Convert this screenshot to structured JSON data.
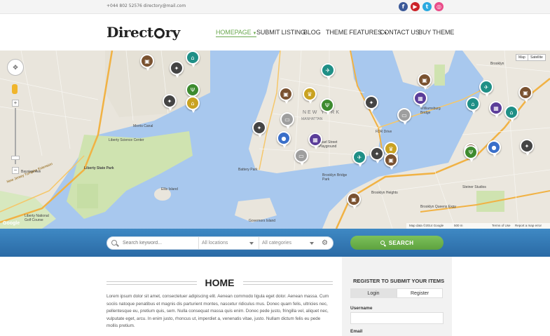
{
  "topbar": {
    "contact": "+044 802 52576 directory@mail.com",
    "social": [
      {
        "name": "facebook-icon",
        "glyph": "f",
        "color": "#3b5998"
      },
      {
        "name": "youtube-icon",
        "glyph": "▶",
        "color": "#cc2127"
      },
      {
        "name": "twitter-icon",
        "glyph": "t",
        "color": "#2aa9e0"
      },
      {
        "name": "dribbble-icon",
        "glyph": "◎",
        "color": "#ea4c89"
      }
    ]
  },
  "header": {
    "logo_left": "Direct",
    "logo_right": "ry",
    "nav": [
      {
        "label": "HOMEPAGE",
        "active": true,
        "dropdown": true
      },
      {
        "label": "SUBMIT LISTING",
        "active": false,
        "dropdown": false
      },
      {
        "label": "BLOG",
        "active": false,
        "dropdown": false
      },
      {
        "label": "THEME FEATURES",
        "active": false,
        "dropdown": true
      },
      {
        "label": "CONTACT US",
        "active": false,
        "dropdown": false
      },
      {
        "label": "BUY THEME",
        "active": false,
        "dropdown": false
      }
    ]
  },
  "map": {
    "type_map": "Map",
    "type_satellite": "Satellite",
    "attribution": "Map data ©2014 Google",
    "scale": "500 m",
    "terms": "Terms of Use",
    "report": "Report a map error",
    "google": "Google",
    "labels": {
      "new_york": "NEW YORK",
      "manhattan": "MANHATTAN",
      "brooklyn_heights": "Brooklyn Heights",
      "brooklyn": "Brooklyn",
      "liberty_state_park": "Liberty State Park",
      "ellis_island": "Ellis Island",
      "battery_park": "Battery Park",
      "governors_island": "Governors Island",
      "liberty_science": "Liberty Science Center",
      "morris_canal": "Morris Canal",
      "williamsburg": "Williamsburg Bridge",
      "brooklyn_bridge": "Brooklyn Bridge Park",
      "fdr_drive": "FDR Drive",
      "pearl_street": "Pearl Street Playground",
      "bqe": "Brooklyn Queens Expy",
      "nj_turnpike": "New Jersey Turnpike Extension",
      "bayview": "Bayview Ave",
      "liberty_national": "Liberty National Golf Course",
      "steiner": "Steiner Studios"
    },
    "pins": [
      {
        "icon": "pin-icon",
        "color": "#7a5230",
        "glyph": "▣"
      },
      {
        "icon": "pin-icon",
        "color": "#1f8f86",
        "glyph": "⌂"
      },
      {
        "icon": "pin-icon",
        "color": "#444",
        "glyph": "✦"
      },
      {
        "icon": "pin-icon",
        "color": "#444",
        "glyph": "✦"
      },
      {
        "icon": "pin-icon",
        "color": "#3d8b2f",
        "glyph": "Ψ"
      },
      {
        "icon": "pin-icon",
        "color": "#c9a221",
        "glyph": "⌂"
      },
      {
        "icon": "pin-icon",
        "color": "#7a5230",
        "glyph": "▣"
      },
      {
        "icon": "pin-icon",
        "color": "#c9a221",
        "glyph": "♛"
      },
      {
        "icon": "pin-icon",
        "color": "#3d8b2f",
        "glyph": "Ψ"
      },
      {
        "icon": "pin-icon",
        "color": "#444",
        "glyph": "✦"
      },
      {
        "icon": "pin-icon",
        "color": "#1f8f86",
        "glyph": "✈"
      },
      {
        "icon": "pin-icon",
        "color": "#7a5230",
        "glyph": "▣"
      },
      {
        "icon": "pin-icon",
        "color": "#5b3d99",
        "glyph": "▦"
      },
      {
        "icon": "pin-icon",
        "color": "#9e9e9e",
        "glyph": "▭"
      },
      {
        "icon": "pin-icon",
        "color": "#9e9e9e",
        "glyph": "▭"
      },
      {
        "icon": "pin-icon",
        "color": "#444",
        "glyph": "✦"
      },
      {
        "icon": "pin-icon",
        "color": "#3a6fc9",
        "glyph": "●"
      },
      {
        "icon": "pin-icon",
        "color": "#5b3d99",
        "glyph": "▦"
      },
      {
        "icon": "pin-icon",
        "color": "#9e9e9e",
        "glyph": "▭"
      },
      {
        "icon": "pin-icon",
        "color": "#3a6fc9",
        "glyph": "●"
      },
      {
        "icon": "pin-icon",
        "color": "#1f8f86",
        "glyph": "✈"
      },
      {
        "icon": "pin-icon",
        "color": "#444",
        "glyph": "✦"
      },
      {
        "icon": "pin-icon",
        "color": "#c9a221",
        "glyph": "♛"
      },
      {
        "icon": "pin-icon",
        "color": "#7a5230",
        "glyph": "▣"
      },
      {
        "icon": "pin-icon",
        "color": "#7a5230",
        "glyph": "▣"
      },
      {
        "icon": "pin-icon",
        "color": "#7a5230",
        "glyph": "▣"
      },
      {
        "icon": "pin-icon",
        "color": "#1f8f86",
        "glyph": "✈"
      },
      {
        "icon": "pin-icon",
        "color": "#5b3d99",
        "glyph": "▦"
      },
      {
        "icon": "pin-icon",
        "color": "#1f8f86",
        "glyph": "⌂"
      },
      {
        "icon": "pin-icon",
        "color": "#1f8f86",
        "glyph": "⌂"
      },
      {
        "icon": "pin-icon",
        "color": "#7a5230",
        "glyph": "▣"
      },
      {
        "icon": "pin-icon",
        "color": "#3d8b2f",
        "glyph": "Ψ"
      },
      {
        "icon": "pin-icon",
        "color": "#3a6fc9",
        "glyph": "●"
      },
      {
        "icon": "pin-icon",
        "color": "#444",
        "glyph": "✦"
      }
    ]
  },
  "search": {
    "keyword_placeholder": "Search keyword...",
    "location": "All locations",
    "category": "All categories",
    "button": "SEARCH"
  },
  "content": {
    "title": "HOME",
    "body": "Lorem ipsum dolor sit amet, consectetuer adipiscing elit. Aenean commodo ligula eget dolor. Aenean massa. Cum sociis natoque penatibus et magnis dis parturient montes, nascetur ridiculus mus. Donec quam felis, ultricies nec, pellentesque eu, pretium quis, sem. Nulla consequat massa quis enim. Donec pede justo, fringilla vel, aliquet nec, vulputate eget, arcu. In enim justo, rhoncus ut, imperdiet a, venenatis vitae, justo. Nullam dictum felis eu pede mollis pretium."
  },
  "sidebar": {
    "title": "REGISTER TO SUBMIT YOUR ITEMS",
    "tab_login": "Login",
    "tab_register": "Register",
    "username_label": "Username",
    "email_label": "Email"
  }
}
